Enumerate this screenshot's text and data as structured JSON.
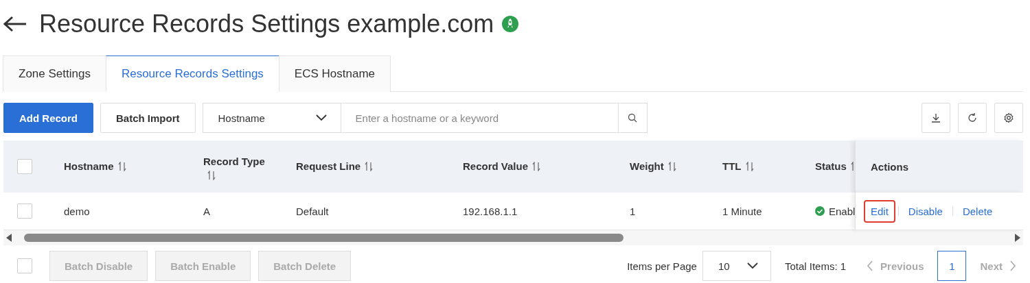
{
  "header": {
    "title": "Resource Records Settings example.com"
  },
  "tabs": [
    {
      "label": "Zone Settings",
      "selected": false
    },
    {
      "label": "Resource Records Settings",
      "selected": true
    },
    {
      "label": "ECS Hostname",
      "selected": false
    }
  ],
  "toolbar": {
    "primary_button": "Add Record",
    "secondary_button": "Batch Import",
    "filter_select": "Hostname",
    "search": {
      "placeholder": "Enter a hostname or a keyword"
    }
  },
  "table": {
    "columns": [
      {
        "label": "Hostname",
        "sortable": true
      },
      {
        "label": "Record Type",
        "sortable": true
      },
      {
        "label": "Request Line",
        "sortable": true
      },
      {
        "label": "Record Value",
        "sortable": true
      },
      {
        "label": "Weight",
        "sortable": true
      },
      {
        "label": "TTL",
        "sortable": true
      },
      {
        "label": "Status",
        "sortable": true
      }
    ],
    "actions_label": "Actions",
    "select_all_checked": false,
    "rows": [
      {
        "checked": false,
        "cells": [
          "demo",
          "A",
          "Default",
          "192.168.1.1",
          "1",
          "1 Minute"
        ],
        "status": {
          "text": "Enabl",
          "enabled": true
        },
        "actions": [
          {
            "label": "Edit",
            "highlighted": true
          },
          {
            "label": "Disable",
            "highlighted": false
          },
          {
            "label": "Delete",
            "highlighted": false
          }
        ]
      }
    ]
  },
  "footer": {
    "select_all_checked": false,
    "batch_buttons": [
      {
        "label": "Batch Disable",
        "disabled": true
      },
      {
        "label": "Batch Enable",
        "disabled": true
      },
      {
        "label": "Batch Delete",
        "disabled": true
      }
    ],
    "items_per_page_label": "Items per Page",
    "page_size": "10",
    "total": "Total Items: 1",
    "previous": "Previous",
    "next": "Next",
    "pages": [
      {
        "label": "1",
        "selected": true
      }
    ]
  }
}
